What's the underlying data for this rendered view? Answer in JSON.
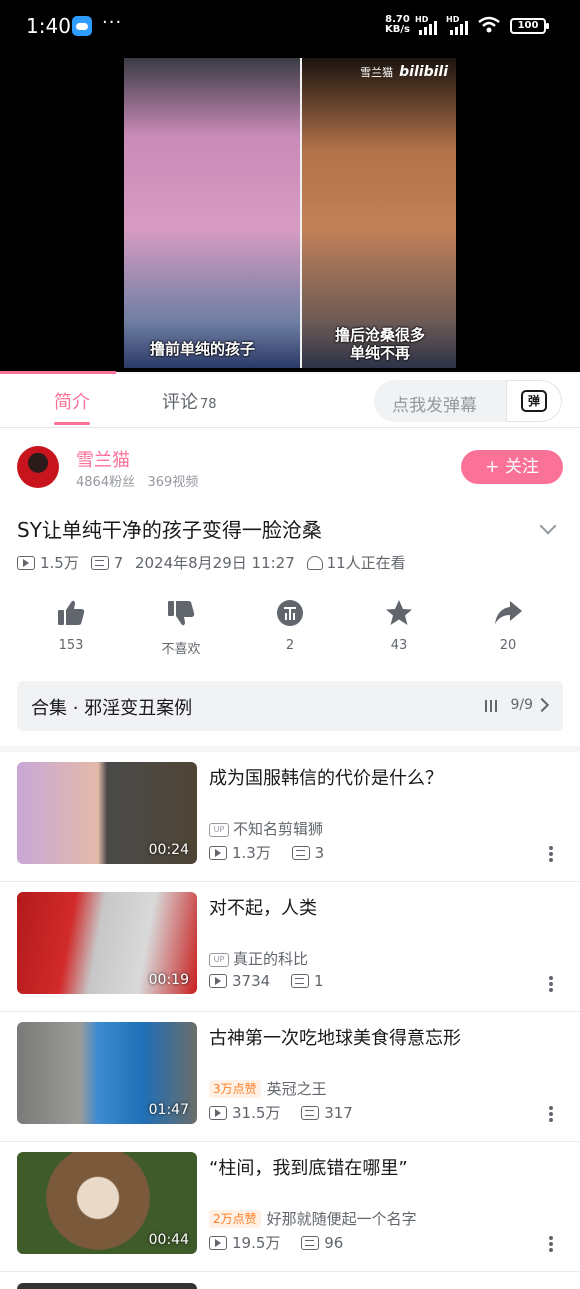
{
  "status_bar": {
    "time": "1:40",
    "more": "···",
    "net_speed_value": "8.70",
    "net_speed_unit": "KB/s",
    "signal_label": "HD",
    "battery": "100"
  },
  "player": {
    "watermark_user": "雪兰猫",
    "watermark_logo": "bilibili",
    "caption_left": "撸前单纯的孩子",
    "caption_right_line1": "撸后沧桑很多",
    "caption_right_line2": "单纯不再",
    "progress_fraction": 0.2
  },
  "tabs": {
    "intro": "简介",
    "comments": "评论",
    "comments_count": "78",
    "danmaku_placeholder": "点我发弹幕",
    "danmaku_icon_char": "弹"
  },
  "uploader": {
    "name": "雪兰猫",
    "fans": "4864粉丝",
    "videos": "369视频",
    "follow_label": "+ 关注"
  },
  "video": {
    "title": "SY让单纯干净的孩子变得一脸沧桑",
    "views": "1.5万",
    "danmaku": "7",
    "datetime": "2024年8月29日 11:27",
    "watching": "11人正在看"
  },
  "actions": [
    {
      "name": "like",
      "label": "153"
    },
    {
      "name": "dislike",
      "label": "不喜欢"
    },
    {
      "name": "coin",
      "label": "2"
    },
    {
      "name": "favorite",
      "label": "43"
    },
    {
      "name": "share",
      "label": "20"
    }
  ],
  "collection": {
    "label": "合集 · 邪淫变丑案例",
    "count": "9/9"
  },
  "related": [
    {
      "title": "成为国服韩信的代价是什么？",
      "duration": "00:24",
      "badge": "UP",
      "uploader": "不知名剪辑狮",
      "views": "1.3万",
      "danmaku": "3"
    },
    {
      "title": "对不起，人类",
      "duration": "00:19",
      "badge": "UP",
      "uploader": "真正的科比",
      "views": "3734",
      "danmaku": "1"
    },
    {
      "title": "古神第一次吃地球美食得意忘形",
      "duration": "01:47",
      "like_tag": "3万点赞",
      "uploader": "英冠之王",
      "views": "31.5万",
      "danmaku": "317"
    },
    {
      "title": "“柱间，我到底错在哪里”",
      "duration": "00:44",
      "like_tag": "2万点赞",
      "uploader": "好那就随便起一个名字",
      "views": "19.5万",
      "danmaku": "96"
    }
  ]
}
